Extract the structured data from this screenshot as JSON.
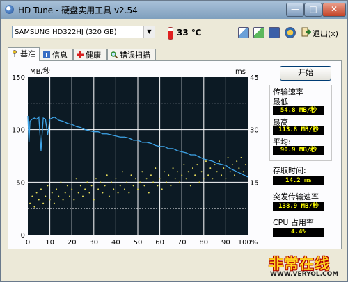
{
  "window": {
    "title": "HD Tune - 硬盘实用工具 v2.54",
    "minimize": "—",
    "maximize": "□",
    "close": "✕"
  },
  "toolbar": {
    "drive": "SAMSUNG HD322HJ (320 GB)",
    "temperature": "33 ℃",
    "exit_label": "退出(x)"
  },
  "tabs": [
    {
      "label": "基准",
      "icon": "pin-icon"
    },
    {
      "label": "信息",
      "icon": "info-icon"
    },
    {
      "label": "健康",
      "icon": "health-cross-icon"
    },
    {
      "label": "错误扫描",
      "icon": "magnifier-icon"
    }
  ],
  "benchmark": {
    "start_button": "开始",
    "transfer_rate": "传输速率",
    "min_label": "最低",
    "min_value": "54.8 MB/秒",
    "max_label": "最高",
    "max_value": "113.8 MB/秒",
    "avg_label": "平均:",
    "avg_value": "90.9 MB/秒",
    "access_label": "存取时间:",
    "access_value": "14.2 ms",
    "burst_label": "突发传输速率",
    "burst_value": "138.9 MB/秒",
    "cpu_label": "CPU 占用率",
    "cpu_value": "4.4%"
  },
  "watermark": {
    "text": "非常在线",
    "url": "WWW.VERYOL.COM"
  },
  "colors": {
    "plot_bg": "#0c1a24",
    "grid": "#ffffff",
    "transfer_line": "#3ea4e8",
    "access_dots": "#e6dc5a"
  },
  "chart_data": {
    "type": "line",
    "ylabel_left": "MB/秒",
    "ylabel_right": "ms",
    "x_ticks": [
      "0",
      "10",
      "20",
      "30",
      "40",
      "50",
      "60",
      "70",
      "80",
      "90",
      "100%"
    ],
    "y_left_ticks": [
      "150",
      "100",
      "50",
      "0"
    ],
    "y_right_ticks": [
      "45",
      "30",
      "15"
    ],
    "ylim_left": [
      0,
      150
    ],
    "ylim_right": [
      0,
      45
    ],
    "grid": true,
    "series": [
      {
        "kind": "transfer_rate",
        "x": [
          0,
          0.5,
          1,
          2,
          3,
          4,
          5,
          6,
          7,
          8,
          9,
          10,
          12,
          14,
          16,
          18,
          20,
          22,
          24,
          26,
          28,
          30,
          32,
          34,
          36,
          38,
          40,
          42,
          44,
          46,
          48,
          50,
          52,
          54,
          56,
          58,
          60,
          62,
          64,
          66,
          68,
          70,
          72,
          74,
          76,
          78,
          80,
          82,
          84,
          86,
          88,
          90,
          92,
          94,
          96,
          98,
          100
        ],
        "y": [
          113,
          88,
          108,
          110,
          111,
          110,
          112,
          80,
          111,
          110,
          95,
          110,
          112,
          109,
          108,
          106,
          105,
          103,
          102,
          100,
          99,
          98,
          98,
          96,
          96,
          95,
          94,
          93,
          93,
          92,
          90,
          90,
          88,
          88,
          87,
          85,
          84,
          84,
          82,
          82,
          80,
          79,
          78,
          76,
          76,
          74,
          72,
          71,
          70,
          68,
          67,
          66,
          63,
          61,
          59,
          57,
          55
        ]
      },
      {
        "kind": "access_time",
        "x": [
          1,
          2,
          3,
          4,
          5,
          6,
          7,
          8,
          9,
          10,
          11,
          12,
          13,
          14,
          15,
          16,
          17,
          18,
          19,
          20,
          21,
          22,
          23,
          24,
          25,
          26,
          27,
          28,
          29,
          30,
          31,
          32,
          33,
          34,
          35,
          36,
          37,
          38,
          39,
          40,
          41,
          42,
          43,
          44,
          45,
          46,
          47,
          48,
          49,
          50,
          51,
          52,
          53,
          54,
          55,
          56,
          57,
          58,
          59,
          60,
          61,
          62,
          63,
          64,
          65,
          66,
          67,
          68,
          69,
          70,
          71,
          72,
          73,
          74,
          75,
          76,
          77,
          78,
          79,
          80,
          81,
          82,
          83,
          84,
          85,
          86,
          87,
          88,
          89,
          90,
          91,
          92,
          93,
          94,
          95,
          96,
          97,
          98,
          99
        ],
        "y": [
          9,
          11,
          8,
          12,
          10,
          13,
          9,
          11,
          14,
          10,
          12,
          9,
          13,
          11,
          15,
          10,
          12,
          14,
          11,
          13,
          10,
          16,
          12,
          14,
          11,
          13,
          15,
          12,
          14,
          10,
          16,
          13,
          15,
          12,
          14,
          17,
          11,
          15,
          13,
          16,
          12,
          14,
          18,
          13,
          15,
          12,
          17,
          14,
          16,
          13,
          15,
          18,
          14,
          16,
          12,
          17,
          15,
          19,
          14,
          16,
          13,
          18,
          15,
          17,
          14,
          19,
          16,
          18,
          15,
          17,
          20,
          16,
          18,
          14,
          19,
          17,
          20,
          15,
          18,
          16,
          21,
          17,
          19,
          16,
          20,
          18,
          21,
          17,
          19,
          16,
          22,
          18,
          20,
          17,
          21,
          19,
          22,
          18,
          20
        ]
      }
    ]
  }
}
